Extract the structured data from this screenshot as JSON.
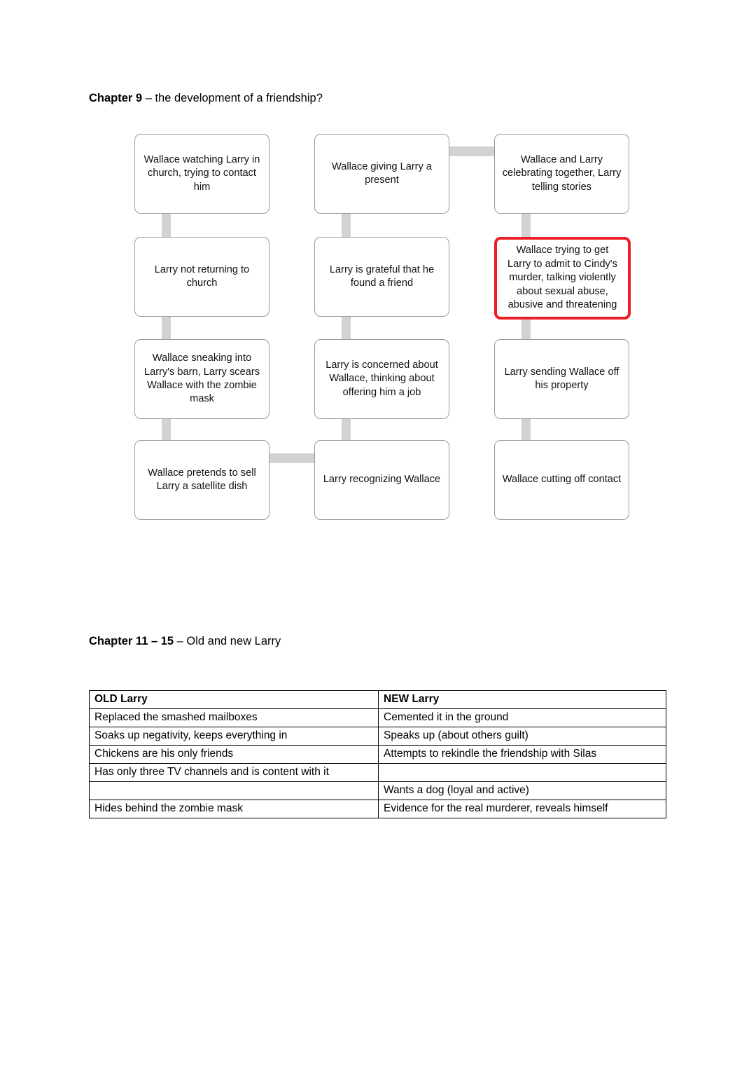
{
  "headings": {
    "chapter9": {
      "bold": "Chapter 9",
      "rest": " – the development of a friendship?"
    },
    "chapter11": {
      "bold": "Chapter 11 – 15",
      "rest": " – Old and new Larry"
    }
  },
  "colors": {
    "highlight_border": "#ee1c25",
    "box_border": "#9a9a9a",
    "connector": "#d2d2d2",
    "table_border": "#000000",
    "text": "#000000"
  },
  "flowchart": {
    "boxes": [
      {
        "id": "r1c1",
        "text": "Wallace watching Larry in church, trying to contact him",
        "highlight": false
      },
      {
        "id": "r1c2",
        "text": "Wallace giving Larry a present",
        "highlight": false
      },
      {
        "id": "r1c3",
        "text": "Wallace and Larry celebrating together, Larry telling stories",
        "highlight": false
      },
      {
        "id": "r2c1",
        "text": "Larry not returning to church",
        "highlight": false
      },
      {
        "id": "r2c2",
        "text": "Larry is grateful that he found a friend",
        "highlight": false
      },
      {
        "id": "r2c3",
        "text": "Wallace trying to get Larry to admit to Cindy's murder, talking violently about sexual abuse, abusive and threatening",
        "highlight": true
      },
      {
        "id": "r3c1",
        "text": "Wallace sneaking into Larry's barn, Larry scears Wallace with the zombie mask",
        "highlight": false
      },
      {
        "id": "r3c2",
        "text": "Larry is concerned about Wallace, thinking about offering him a job",
        "highlight": false
      },
      {
        "id": "r3c3",
        "text": "Larry sending Wallace off his property",
        "highlight": false
      },
      {
        "id": "r4c1",
        "text": "Wallace pretends to sell Larry a satellite dish",
        "highlight": false
      },
      {
        "id": "r4c2",
        "text": "Larry recognizing Wallace",
        "highlight": false
      },
      {
        "id": "r4c3",
        "text": "Wallace cutting off contact",
        "highlight": false
      }
    ]
  },
  "table": {
    "headers": [
      "OLD Larry",
      "NEW Larry"
    ],
    "rows": [
      [
        "Replaced the smashed mailboxes",
        "Cemented it in the ground"
      ],
      [
        "Soaks up negativity, keeps everything in",
        "Speaks up (about others guilt)"
      ],
      [
        "Chickens are his only friends",
        "Attempts to rekindle the friendship with Silas"
      ],
      [
        "Has only three TV channels and is content with it",
        ""
      ],
      [
        "",
        "Wants a dog (loyal and active)"
      ],
      [
        "Hides behind the zombie mask",
        "Evidence for the real murderer, reveals himself"
      ]
    ]
  }
}
